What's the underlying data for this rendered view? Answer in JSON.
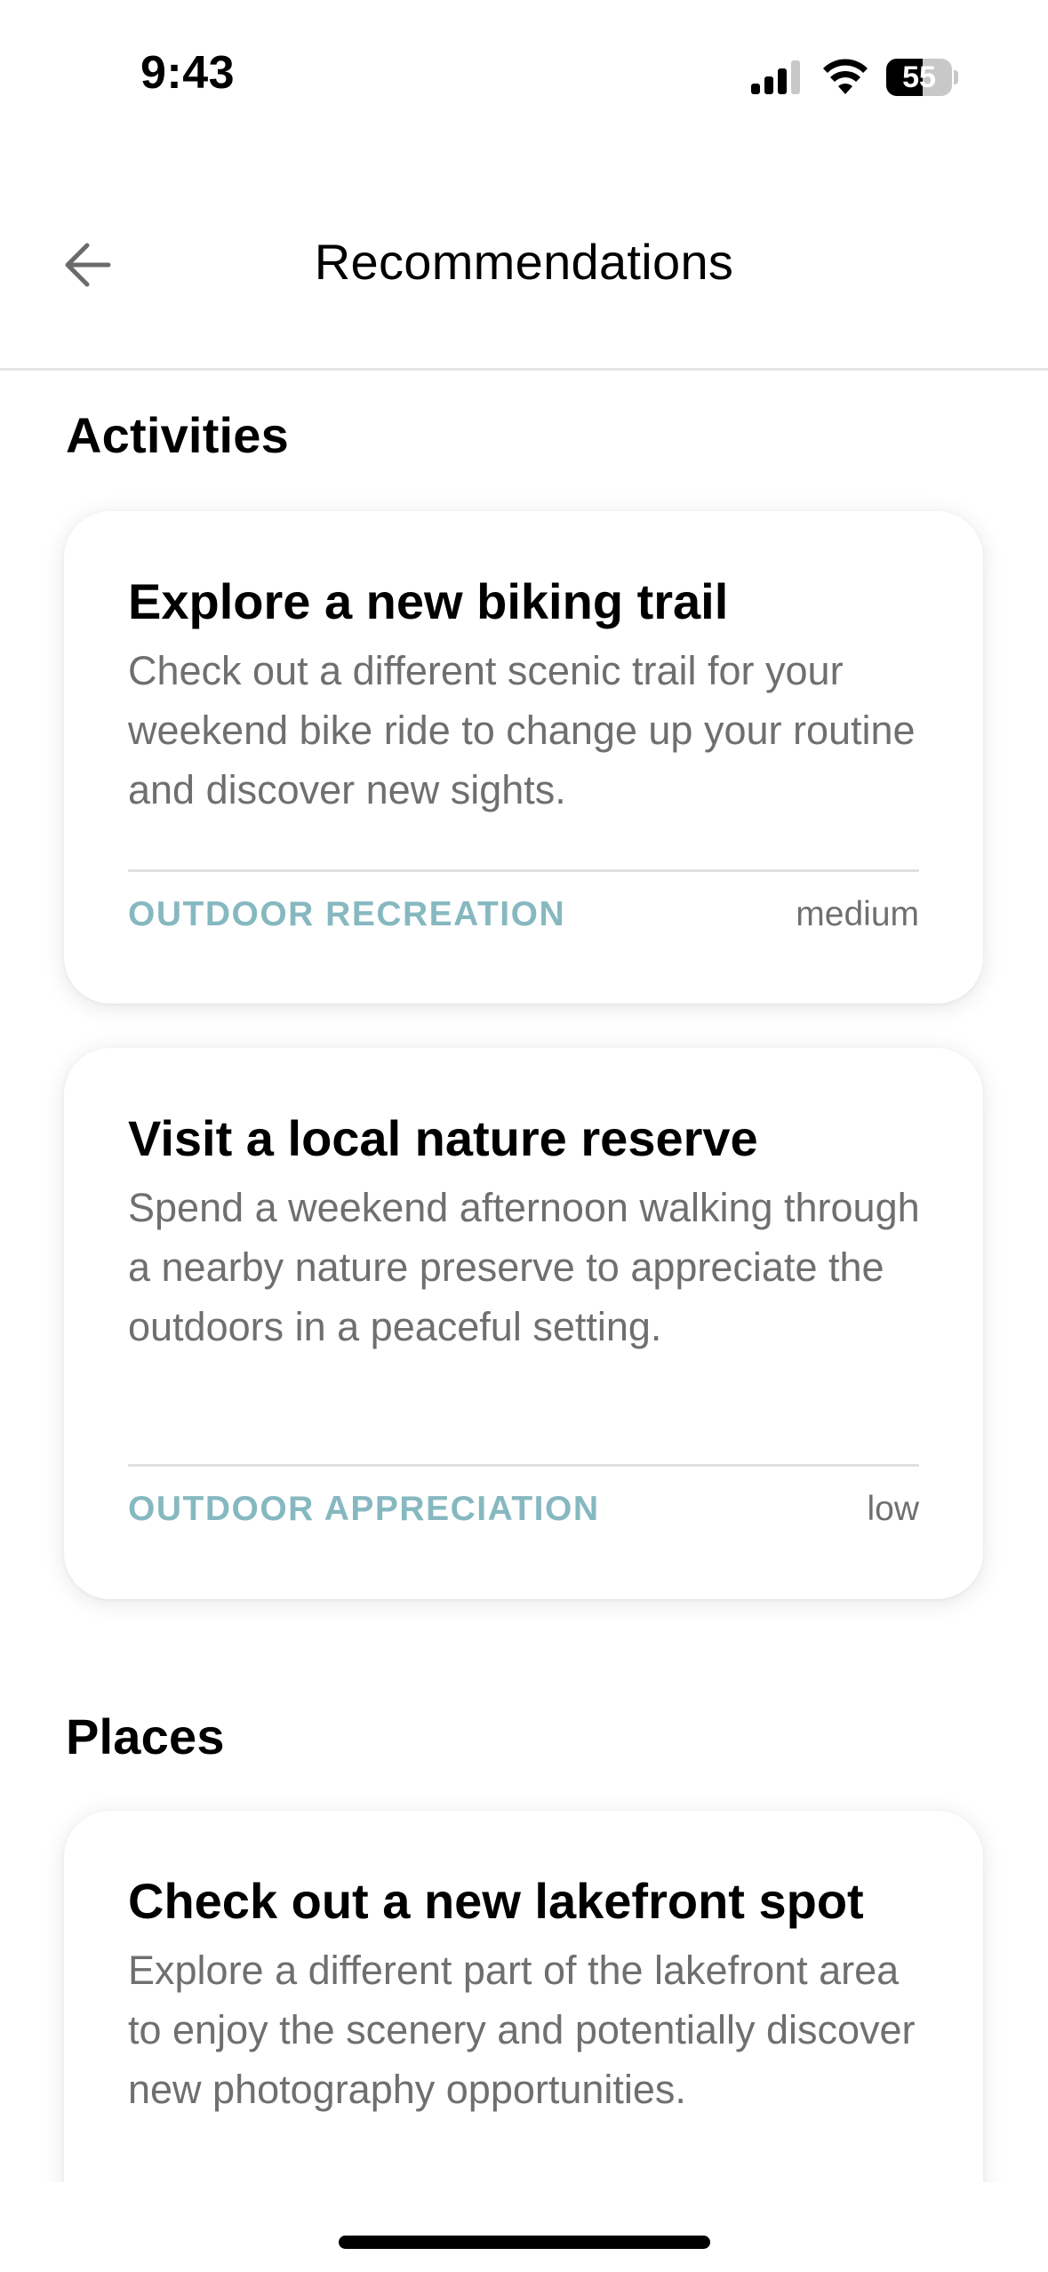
{
  "status_bar": {
    "time": "9:43",
    "battery_percent": "55",
    "battery_level": 0.55,
    "icons": [
      "signal-icon",
      "wifi-icon",
      "battery-icon"
    ]
  },
  "header": {
    "back_icon": "arrow-left-icon",
    "title": "Recommendations"
  },
  "sections": {
    "activities": {
      "heading": "Activities",
      "cards": [
        {
          "title": "Explore a new biking trail",
          "description": "Check out a different scenic trail for your weekend bike ride to change up your routine and discover new sights.",
          "category": "OUTDOOR RECREATION",
          "level": "medium"
        },
        {
          "title": "Visit a local nature reserve",
          "description": "Spend a weekend afternoon walking through a nearby nature preserve to appreciate the outdoors in a peaceful setting.",
          "category": "OUTDOOR APPRECIATION",
          "level": "low"
        }
      ]
    },
    "places": {
      "heading": "Places",
      "cards": [
        {
          "title": "Check out a new lakefront spot",
          "description": "Explore a different part of the lakefront area to enjoy the scenery and potentially discover new photography opportunities."
        }
      ]
    }
  },
  "colors": {
    "category_accent": "#86b8c0",
    "secondary_text": "#6f6f6f",
    "divider": "#e0e0e0"
  }
}
